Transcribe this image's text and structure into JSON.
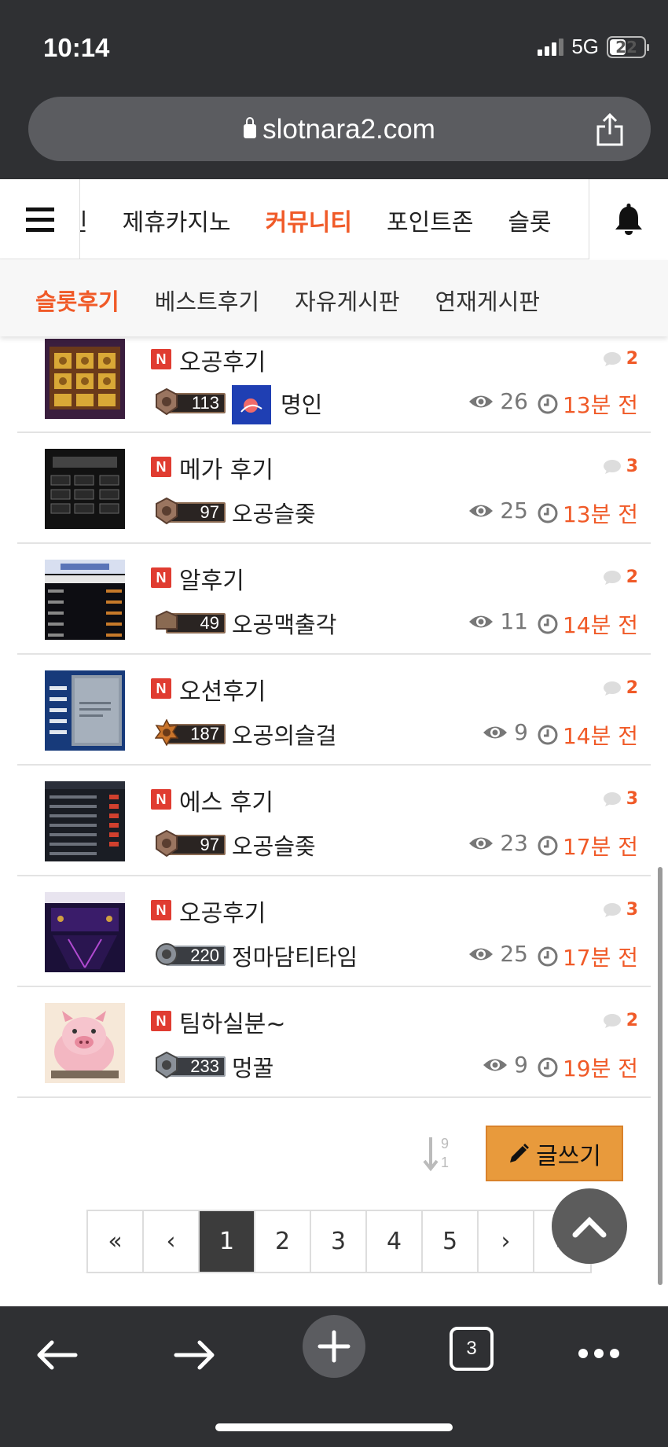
{
  "status_bar": {
    "time": "10:14",
    "network": "5G",
    "battery": "22"
  },
  "browser": {
    "url": "slotnara2.com"
  },
  "main_nav": {
    "items": [
      {
        "label": "인"
      },
      {
        "label": "제휴카지노"
      },
      {
        "label": "커뮤니티",
        "active": true
      },
      {
        "label": "포인트존"
      },
      {
        "label": "슬롯"
      }
    ]
  },
  "sub_nav": {
    "items": [
      {
        "label": "슬롯후기",
        "active": true
      },
      {
        "label": "베스트후기"
      },
      {
        "label": "자유게시판"
      },
      {
        "label": "연재게시판"
      }
    ]
  },
  "posts": [
    {
      "title": "오공후기",
      "comments": "2",
      "level": "113",
      "author": "명인",
      "views": "26",
      "time": "13분 전",
      "has_avatar": true
    },
    {
      "title": "메가 후기",
      "comments": "3",
      "level": "97",
      "author": "오공슬좆",
      "views": "25",
      "time": "13분 전"
    },
    {
      "title": "알후기",
      "comments": "2",
      "level": "49",
      "author": "오공맥출각",
      "views": "11",
      "time": "14분 전"
    },
    {
      "title": "오션후기",
      "comments": "2",
      "level": "187",
      "author": "오공의슬걸",
      "views": "9",
      "time": "14분 전"
    },
    {
      "title": "에스 후기",
      "comments": "3",
      "level": "97",
      "author": "오공슬좆",
      "views": "23",
      "time": "17분 전"
    },
    {
      "title": "오공후기",
      "comments": "3",
      "level": "220",
      "author": "정마담티타임",
      "views": "25",
      "time": "17분 전"
    },
    {
      "title": "팀하실분~",
      "comments": "2",
      "level": "233",
      "author": "멍꿀",
      "views": "9",
      "time": "19분 전"
    }
  ],
  "badge_label": "N",
  "sort_digits": {
    "top": "9",
    "bottom": "1"
  },
  "write_button": {
    "label": "글쓰기"
  },
  "pagination": {
    "first": "«",
    "prev": "‹",
    "pages": [
      "1",
      "2",
      "3",
      "4",
      "5"
    ],
    "current": "1",
    "next": "›",
    "last": "»"
  },
  "toolbar": {
    "tabs_count": "3"
  },
  "colors": {
    "accent": "#f05a28",
    "write_button": "#e89a3c",
    "badge": "#e03c31",
    "chrome": "#2f3033"
  }
}
